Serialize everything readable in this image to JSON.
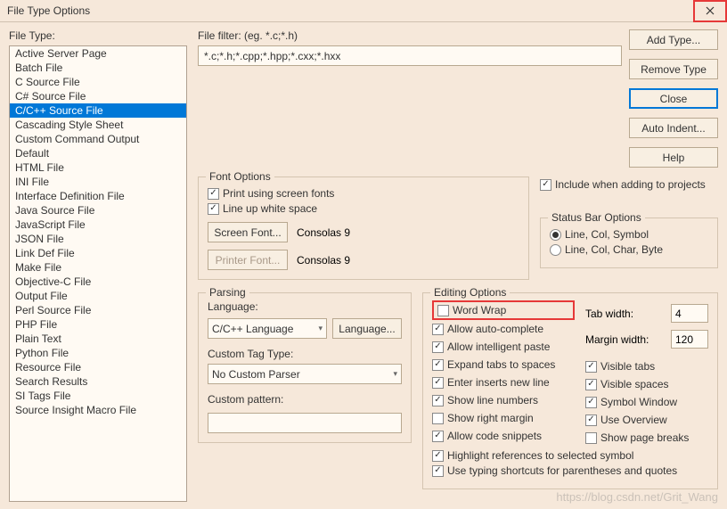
{
  "window": {
    "title": "File Type Options"
  },
  "left": {
    "label": "File Type:",
    "items": [
      "Active Server Page",
      "Batch File",
      "C Source File",
      "C# Source File",
      "C/C++ Source File",
      "Cascading Style Sheet",
      "Custom Command Output",
      "Default",
      "HTML File",
      "INI File",
      "Interface Definition File",
      "Java Source File",
      "JavaScript File",
      "JSON File",
      "Link Def File",
      "Make File",
      "Objective-C File",
      "Output File",
      "Perl Source File",
      "PHP File",
      "Plain Text",
      "Python File",
      "Resource File",
      "Search Results",
      "SI Tags File",
      "Source Insight Macro File"
    ],
    "selected_index": 4
  },
  "filter": {
    "label": "File filter: (eg. *.c;*.h)",
    "value": "*.c;*.h;*.cpp;*.hpp;*.cxx;*.hxx"
  },
  "buttons": {
    "add": "Add Type...",
    "remove": "Remove Type",
    "close": "Close",
    "autoindent": "Auto Indent...",
    "help": "Help"
  },
  "include_projects": "Include when adding to projects",
  "font": {
    "legend": "Font Options",
    "print_screen": "Print using screen fonts",
    "lineup": "Line up white space",
    "screen_btn": "Screen Font...",
    "printer_btn": "Printer Font...",
    "screen_val": "Consolas 9",
    "printer_val": "Consolas 9"
  },
  "status": {
    "legend": "Status Bar Options",
    "opt1": "Line, Col, Symbol",
    "opt2": "Line, Col, Char, Byte"
  },
  "parsing": {
    "legend": "Parsing",
    "lang_label": "Language:",
    "lang_value": "C/C++ Language",
    "lang_btn": "Language...",
    "tag_label": "Custom Tag Type:",
    "tag_value": "No Custom Parser",
    "pattern_label": "Custom pattern:",
    "pattern_value": ""
  },
  "editing": {
    "legend": "Editing Options",
    "word_wrap": "Word Wrap",
    "auto_complete": "Allow auto-complete",
    "intelligent_paste": "Allow intelligent paste",
    "expand_tabs": "Expand tabs to spaces",
    "enter_newline": "Enter inserts new line",
    "line_numbers": "Show line numbers",
    "right_margin": "Show right margin",
    "code_snippets": "Allow code snippets",
    "highlight_refs": "Highlight references to selected symbol",
    "typing_shortcuts": "Use typing shortcuts for parentheses and quotes",
    "tab_width_label": "Tab width:",
    "tab_width": "4",
    "margin_width_label": "Margin width:",
    "margin_width": "120",
    "visible_tabs": "Visible tabs",
    "visible_spaces": "Visible spaces",
    "symbol_window": "Symbol Window",
    "use_overview": "Use Overview",
    "page_breaks": "Show page breaks"
  },
  "watermark": "https://blog.csdn.net/Grit_Wang"
}
